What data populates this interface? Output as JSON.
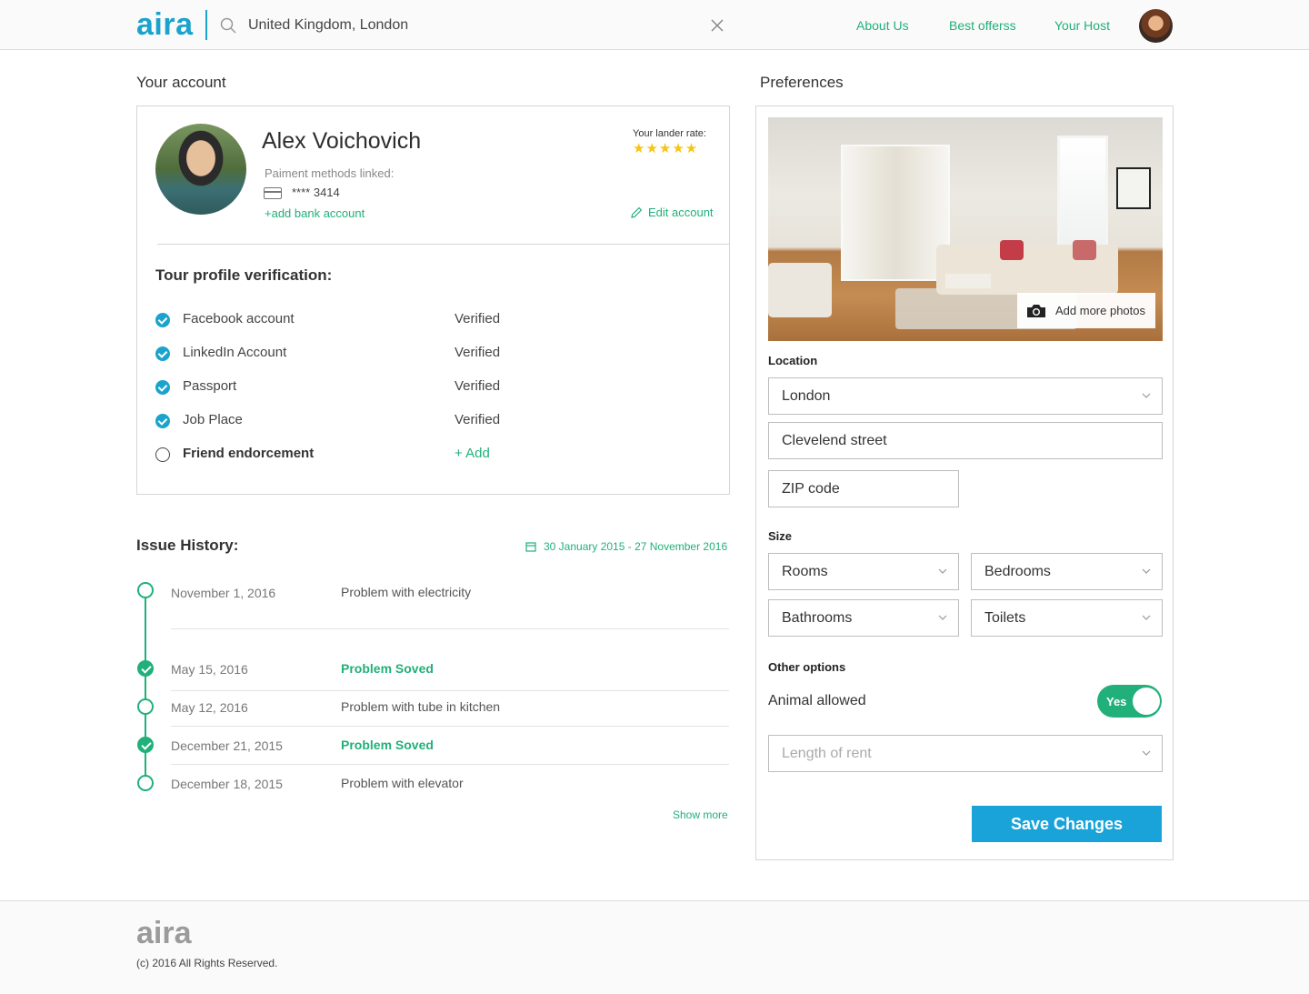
{
  "header": {
    "logo": "aira",
    "search_value": "United Kingdom, London",
    "nav": [
      "About Us",
      "Best offerss",
      "Your Host"
    ]
  },
  "account": {
    "section_title": "Your account",
    "name": "Alex Voichovich",
    "payment_label": "Paiment methods linked:",
    "card_number": "**** 3414",
    "add_bank": "+add bank account",
    "rate_label": "Your lander rate:",
    "rating_stars": "★★★★★",
    "rating": 5,
    "edit_account": "Edit account",
    "verification_title": "Tour profile verification:",
    "verifications": [
      {
        "label": "Facebook account",
        "status": "Verified",
        "verified": true
      },
      {
        "label": "LinkedIn Account",
        "status": "Verified",
        "verified": true
      },
      {
        "label": "Passport",
        "status": "Verified",
        "verified": true
      },
      {
        "label": "Job Place",
        "status": "Verified",
        "verified": true
      },
      {
        "label": "Friend endorcement",
        "status": "+ Add",
        "verified": false
      }
    ]
  },
  "issues": {
    "title": "Issue History:",
    "date_range": "30 January 2015 - 27 November 2016",
    "items": [
      {
        "date": "November 1, 2016",
        "text": "Problem with electricity",
        "solved": false
      },
      {
        "date": "May 15, 2016",
        "text": "Problem Soved",
        "solved": true
      },
      {
        "date": "May 12, 2016",
        "text": "Problem with tube in kitchen",
        "solved": false
      },
      {
        "date": "December 21, 2015",
        "text": "Problem Soved",
        "solved": true
      },
      {
        "date": "December 18, 2015",
        "text": "Problem with elevator",
        "solved": false
      }
    ],
    "show_more": "Show more"
  },
  "preferences": {
    "section_title": "Preferences",
    "add_photos": "Add more photos",
    "location_label": "Location",
    "city": "London",
    "street": "Clevelend street",
    "zip_placeholder": "ZIP code",
    "size_label": "Size",
    "rooms": "Rooms",
    "bedrooms": "Bedrooms",
    "bathrooms": "Bathrooms",
    "toilets": "Toilets",
    "other_label": "Other options",
    "animal_label": "Animal allowed",
    "animal_value": "Yes",
    "rent_placeholder": "Length of rent",
    "save": "Save Changes"
  },
  "footer": {
    "logo": "aira",
    "copyright": "(c) 2016 All Rights Reserved."
  },
  "colors": {
    "brand_blue": "#1aa3cc",
    "accent_green": "#21b07a",
    "star_yellow": "#f5c518",
    "save_blue": "#1aa3d9"
  }
}
